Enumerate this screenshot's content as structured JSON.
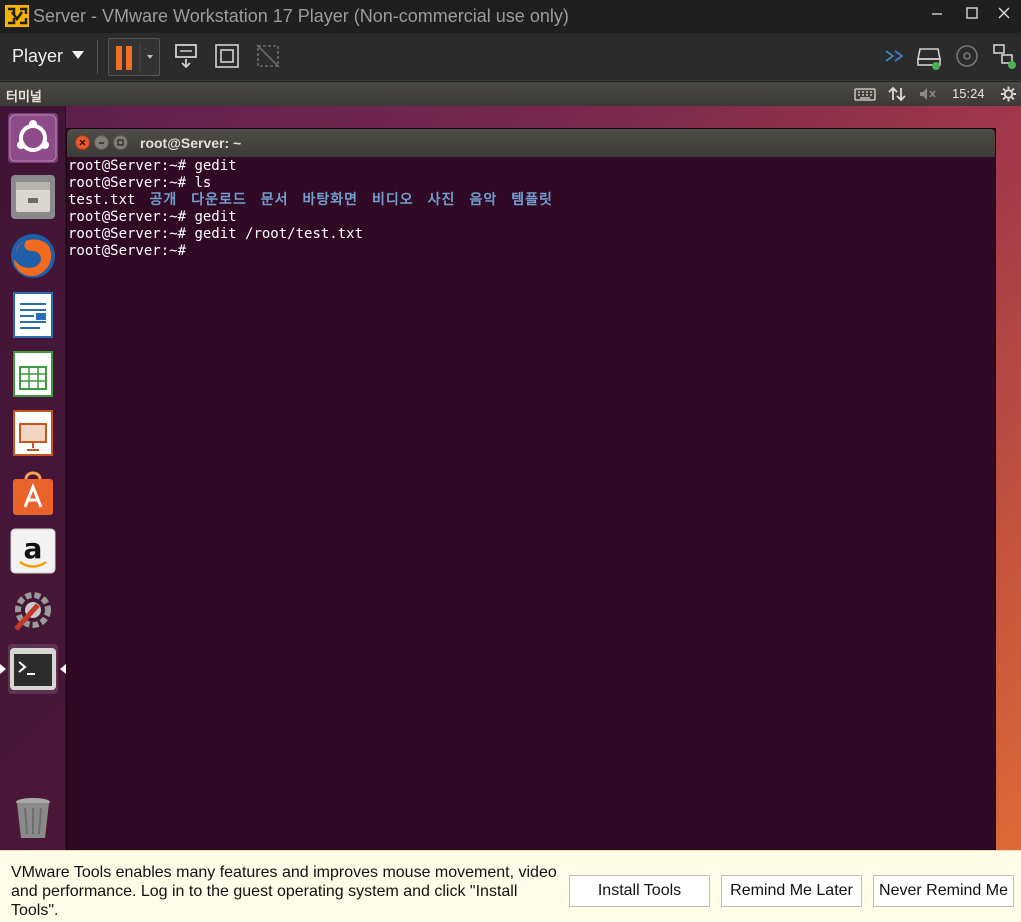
{
  "window": {
    "title": "Server - VMware Workstation 17 Player (Non-commercial use only)"
  },
  "toolbar": {
    "player_label": "Player"
  },
  "ubuntu_panel": {
    "app_title": "터미널",
    "clock": "15:24"
  },
  "terminal": {
    "title": "root@Server: ~",
    "lines": [
      {
        "prompt": "root@Server:~# ",
        "cmd": "gedit"
      },
      {
        "prompt": "root@Server:~# ",
        "cmd": "ls"
      },
      {
        "file": "test.txt",
        "dirs": [
          "공개",
          "다운로드",
          "문서",
          "바탕화면",
          "비디오",
          "사진",
          "음악",
          "템플릿"
        ]
      },
      {
        "prompt": "root@Server:~# ",
        "cmd": "gedit"
      },
      {
        "prompt": "root@Server:~# ",
        "cmd": "gedit /root/test.txt"
      },
      {
        "prompt": "root@Server:~# ",
        "cmd": ""
      }
    ]
  },
  "notification": {
    "message": "VMware Tools enables many features and improves mouse movement, video and performance. Log in to the guest operating system and click \"Install Tools\".",
    "install_label": "Install Tools",
    "remind_label": "Remind Me Later",
    "never_label": "Never Remind Me"
  },
  "colors": {
    "terminal_bg": "#300a24",
    "dir_color": "#729fcf",
    "pause_orange": "#f36f21",
    "notify_bg": "#fffde8"
  }
}
